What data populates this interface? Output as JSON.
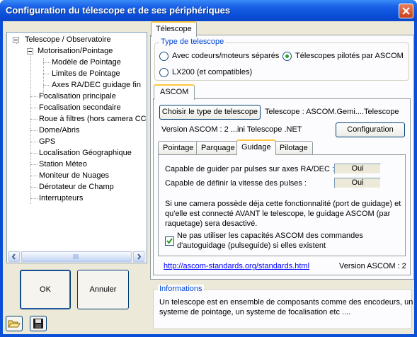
{
  "window": {
    "title": "Configuration du télescope et de ses périphériques"
  },
  "tree": {
    "items": [
      "Telescope / Observatoire",
      "Motorisation/Pointage",
      "Modèle de Pointage",
      "Limites de Pointage",
      "Axes RA/DEC guidage fin",
      "Focalisation principale",
      "Focalisation secondaire",
      "Roue à filtres (hors camera CCD)",
      "Dome/Abris",
      "GPS",
      "Localisation Géographique",
      "Station Méteo",
      "Moniteur de Nuages",
      "Dérotateur de Champ",
      "Interrupteurs"
    ]
  },
  "buttons": {
    "ok": "OK",
    "cancel": "Annuler"
  },
  "main_tab": "Télescope",
  "type_group": {
    "label": "Type de telescope",
    "options": [
      {
        "label": "Avec codeurs/moteurs séparés",
        "checked": false
      },
      {
        "label": "Télescopes pilotés par ASCOM",
        "checked": true
      },
      {
        "label": "LX200 (et compatibles)",
        "checked": false
      }
    ]
  },
  "ascom": {
    "tab": "ASCOM",
    "choose_button": "Choisir le type de telescope",
    "telescope_text": "Telescope : ASCOM.Gemi....Telescope",
    "version_text": "Version ASCOM : 2 ...ini Telescope .NET",
    "config_button": "Configuration",
    "subtabs": [
      "Pointage",
      "Parquage",
      "Guidage",
      "Pilotage"
    ],
    "active_subtab": "Guidage",
    "guidage": {
      "pulse_label": "Capable de guider par pulses  sur axes RA/DEC :",
      "pulse_value": "Oui",
      "speed_label": "Capable de définir la vitesse des pulses :",
      "speed_value": "Oui",
      "info_line1": "Si une camera possède déja cette fonctionnalité (port de guidage) et",
      "info_line2": "qu'elle est connecté AVANT le telescope, le guidage ASCOM (par",
      "info_line3": "raquetage) sera desactivé.",
      "checkbox_line1": "Ne pas utiliser les capacités ASCOM des commandes",
      "checkbox_line2": "d'autoguidage (pulseguide) si elles existent",
      "checkbox_checked": true
    },
    "link": "http://ascom-standards.org/standards.html",
    "version_footer": "Version ASCOM : 2"
  },
  "informations": {
    "label": "Informations",
    "line1": "Un telescope est en ensemble de composants comme des encodeurs, un",
    "line2": "systeme de pointage, un systeme de focalisation etc ...."
  },
  "icons": [
    "folder-open-icon",
    "floppy-disk-icon",
    "close-icon"
  ]
}
